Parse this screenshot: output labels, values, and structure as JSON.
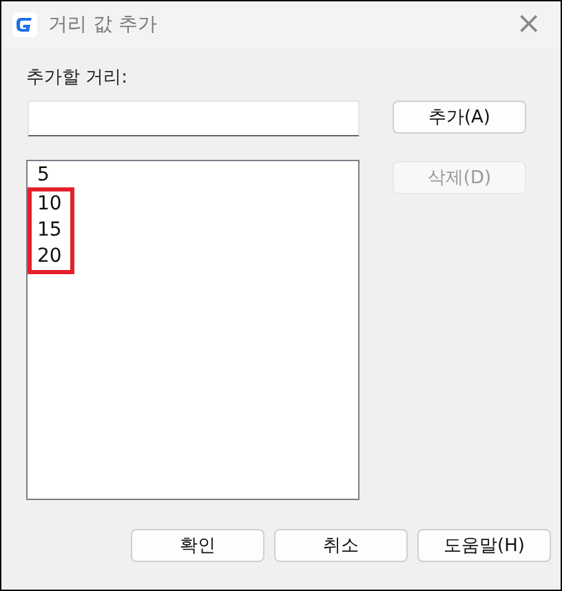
{
  "window": {
    "title": "거리 값 추가",
    "close": "×"
  },
  "field": {
    "label": "추가할 거리:"
  },
  "buttons": {
    "add": {
      "label": "추가(A)",
      "disabled": false
    },
    "delete": {
      "label": "삭제(D)",
      "disabled": true
    }
  },
  "list": [
    {
      "text": "5",
      "highlighted": false
    },
    {
      "text": "10",
      "highlighted": true
    },
    {
      "text": "15",
      "highlighted": true
    },
    {
      "text": "20",
      "highlighted": true
    }
  ],
  "footer": [
    {
      "label": "확인"
    },
    {
      "label": "취소"
    },
    {
      "label": "도움말(H)"
    }
  ]
}
